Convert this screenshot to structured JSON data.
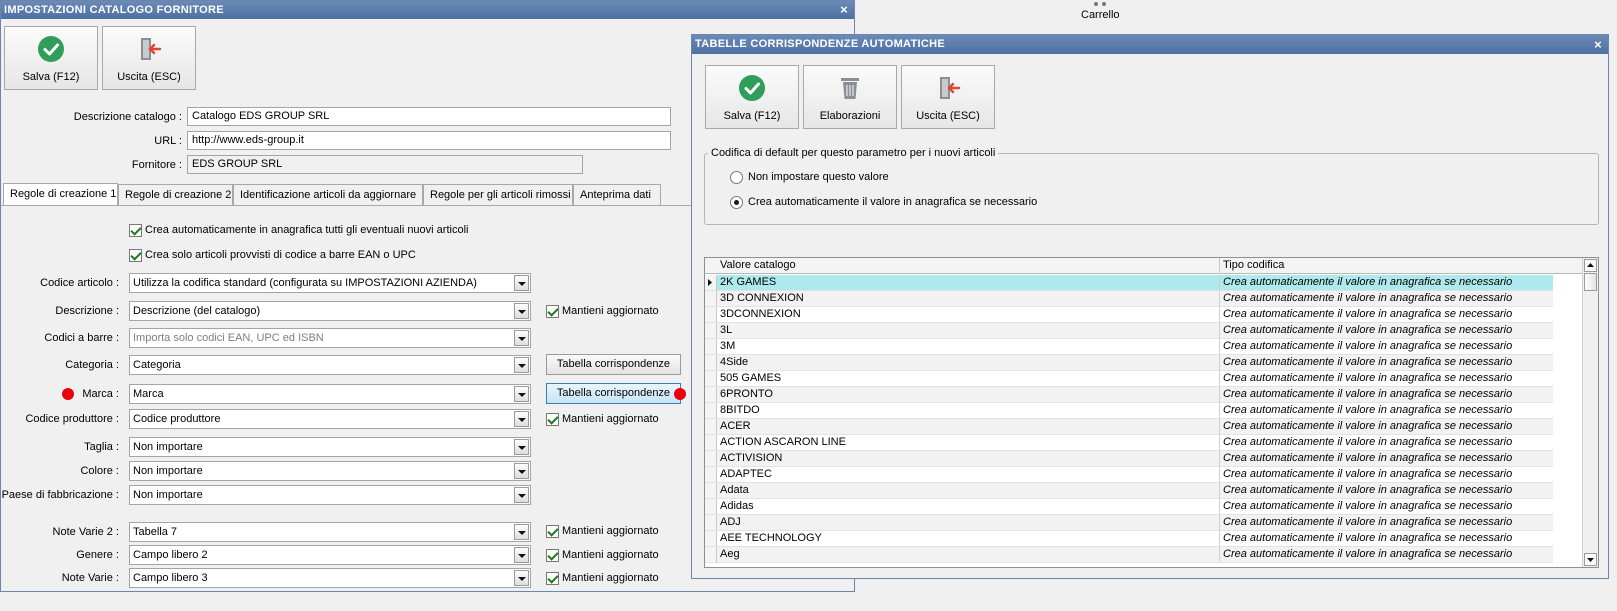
{
  "background": {
    "cart_label": "Carrello"
  },
  "main": {
    "title": "IMPOSTAZIONI CATALOGO FORNITORE",
    "close_glyph": "×",
    "toolbar": {
      "save": "Salva (F12)",
      "exit": "Uscita (ESC)"
    },
    "fields": {
      "descrizione_label": "Descrizione catalogo :",
      "descrizione_value": "Catalogo EDS GROUP SRL",
      "url_label": "URL :",
      "url_value": "http://www.eds-group.it",
      "fornitore_label": "Fornitore :",
      "fornitore_value": "EDS GROUP SRL"
    },
    "tabs": [
      "Regole di creazione 1",
      "Regole di creazione 2",
      "Identificazione articoli da aggiornare",
      "Regole per gli articoli rimossi",
      "Anteprima dati"
    ],
    "active_tab": "Regole di creazione 1",
    "checks": {
      "auto_create": "Crea automaticamente in anagrafica tutti gli eventuali nuovi articoli",
      "only_barcode": "Crea solo articoli provvisti di codice a barre EAN o UPC"
    },
    "rules": {
      "codice_articolo_label": "Codice articolo :",
      "codice_articolo_value": "Utilizza la codifica standard (configurata su IMPOSTAZIONI AZIENDA)",
      "descrizione_label": "Descrizione :",
      "descrizione_value": "Descrizione (del catalogo)",
      "codici_barre_label": "Codici a barre :",
      "codici_barre_value": "Importa solo codici EAN, UPC ed ISBN",
      "categoria_label": "Categoria :",
      "categoria_value": "Categoria",
      "marca_label": "Marca :",
      "marca_value": "Marca",
      "codice_produttore_label": "Codice produttore :",
      "codice_produttore_value": "Codice produttore",
      "taglia_label": "Taglia :",
      "taglia_value": "Non importare",
      "colore_label": "Colore :",
      "colore_value": "Non importare",
      "paese_label": "Paese di fabbricazione :",
      "paese_value": "Non importare",
      "note_varie2_label": "Note Varie 2 :",
      "note_varie2_value": "Tabella 7",
      "genere_label": "Genere :",
      "genere_value": "Campo libero 2",
      "note_varie_label": "Note Varie :",
      "note_varie_value": "Campo libero 3",
      "mantieni": "Mantieni aggiornato",
      "tabella_btn": "Tabella corrispondenze"
    },
    "accent_red": "#e8000b"
  },
  "dialog": {
    "title": "TABELLE CORRISPONDENZE AUTOMATICHE",
    "close_glyph": "×",
    "toolbar": {
      "save": "Salva (F12)",
      "elab": "Elaborazioni",
      "exit": "Uscita (ESC)"
    },
    "group_title": "Codifica di default per questo parametro per i nuovi articoli",
    "radio_none": "Non impostare questo valore",
    "radio_create": "Crea automaticamente il valore in anagrafica se necessario",
    "radio_selected": "radio_create",
    "grid": {
      "col1": "Valore catalogo",
      "col2": "Tipo codifica",
      "rows": [
        [
          "2K GAMES",
          "Crea automaticamente il valore in anagrafica se necessario"
        ],
        [
          "3D CONNEXION",
          "Crea automaticamente il valore in anagrafica se necessario"
        ],
        [
          "3DCONNEXION",
          "Crea automaticamente il valore in anagrafica se necessario"
        ],
        [
          "3L",
          "Crea automaticamente il valore in anagrafica se necessario"
        ],
        [
          "3M",
          "Crea automaticamente il valore in anagrafica se necessario"
        ],
        [
          "4Side",
          "Crea automaticamente il valore in anagrafica se necessario"
        ],
        [
          "505 GAMES",
          "Crea automaticamente il valore in anagrafica se necessario"
        ],
        [
          "6PRONTO",
          "Crea automaticamente il valore in anagrafica se necessario"
        ],
        [
          "8BITDO",
          "Crea automaticamente il valore in anagrafica se necessario"
        ],
        [
          "ACER",
          "Crea automaticamente il valore in anagrafica se necessario"
        ],
        [
          "ACTION ASCARON LINE",
          "Crea automaticamente il valore in anagrafica se necessario"
        ],
        [
          "ACTIVISION",
          "Crea automaticamente il valore in anagrafica se necessario"
        ],
        [
          "ADAPTEC",
          "Crea automaticamente il valore in anagrafica se necessario"
        ],
        [
          "Adata",
          "Crea automaticamente il valore in anagrafica se necessario"
        ],
        [
          "Adidas",
          "Crea automaticamente il valore in anagrafica se necessario"
        ],
        [
          "ADJ",
          "Crea automaticamente il valore in anagrafica se necessario"
        ],
        [
          "AEE TECHNOLOGY",
          "Crea automaticamente il valore in anagrafica se necessario"
        ],
        [
          "Aeg",
          "Crea automaticamente il valore in anagrafica se necessario"
        ]
      ]
    }
  }
}
